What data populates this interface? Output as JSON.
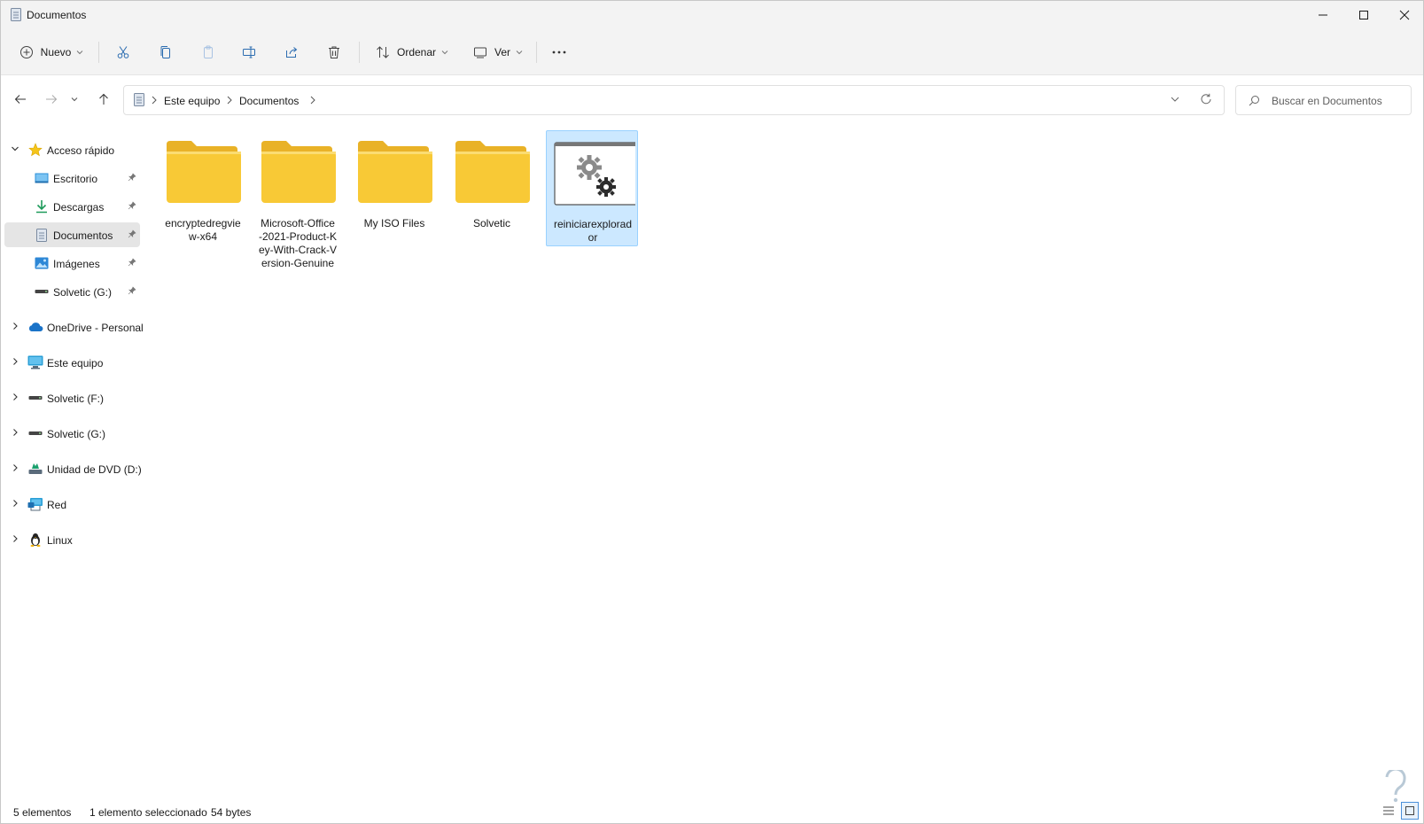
{
  "window": {
    "title": "Documentos"
  },
  "toolbar": {
    "new_label": "Nuevo",
    "sort_label": "Ordenar",
    "view_label": "Ver",
    "more_label": "···"
  },
  "address": {
    "crumbs": [
      "Este equipo",
      "Documentos"
    ]
  },
  "search": {
    "placeholder": "Buscar en Documentos"
  },
  "nav": {
    "quick_access": "Acceso rápido",
    "pinned": [
      "Escritorio",
      "Descargas",
      "Documentos",
      "Imágenes",
      "Solvetic (G:)"
    ],
    "roots": [
      "OneDrive - Personal",
      "Este equipo",
      "Solvetic (F:)",
      "Solvetic (G:)",
      "Unidad de DVD (D:)",
      "Red",
      "Linux"
    ]
  },
  "files": [
    {
      "name": "encryptedregview-x64",
      "display": "encryptedregvie\nw-x64",
      "type": "folder"
    },
    {
      "name": "Microsoft-Office-2021-Product-Key-With-Crack-Version-Genuine",
      "display": "Microsoft-Office\n-2021-Product-K\ney-With-Crack-V\nersion-Genuine",
      "type": "folder"
    },
    {
      "name": "My ISO Files",
      "display": "My ISO Files",
      "type": "folder"
    },
    {
      "name": "Solvetic",
      "display": "Solvetic",
      "type": "folder"
    },
    {
      "name": "reiniciarexplorador",
      "display": "reiniciarexplorad\nor",
      "type": "settings-file",
      "selected": true
    }
  ],
  "status": {
    "count": "5 elementos",
    "selection": "1 elemento seleccionado",
    "size": "54 bytes"
  },
  "colors": {
    "folder": "#f8c936",
    "folder_dark": "#e9b227",
    "selection_bg": "#cce8ff",
    "selection_border": "#99d1ff",
    "accent": "#0067c0"
  }
}
